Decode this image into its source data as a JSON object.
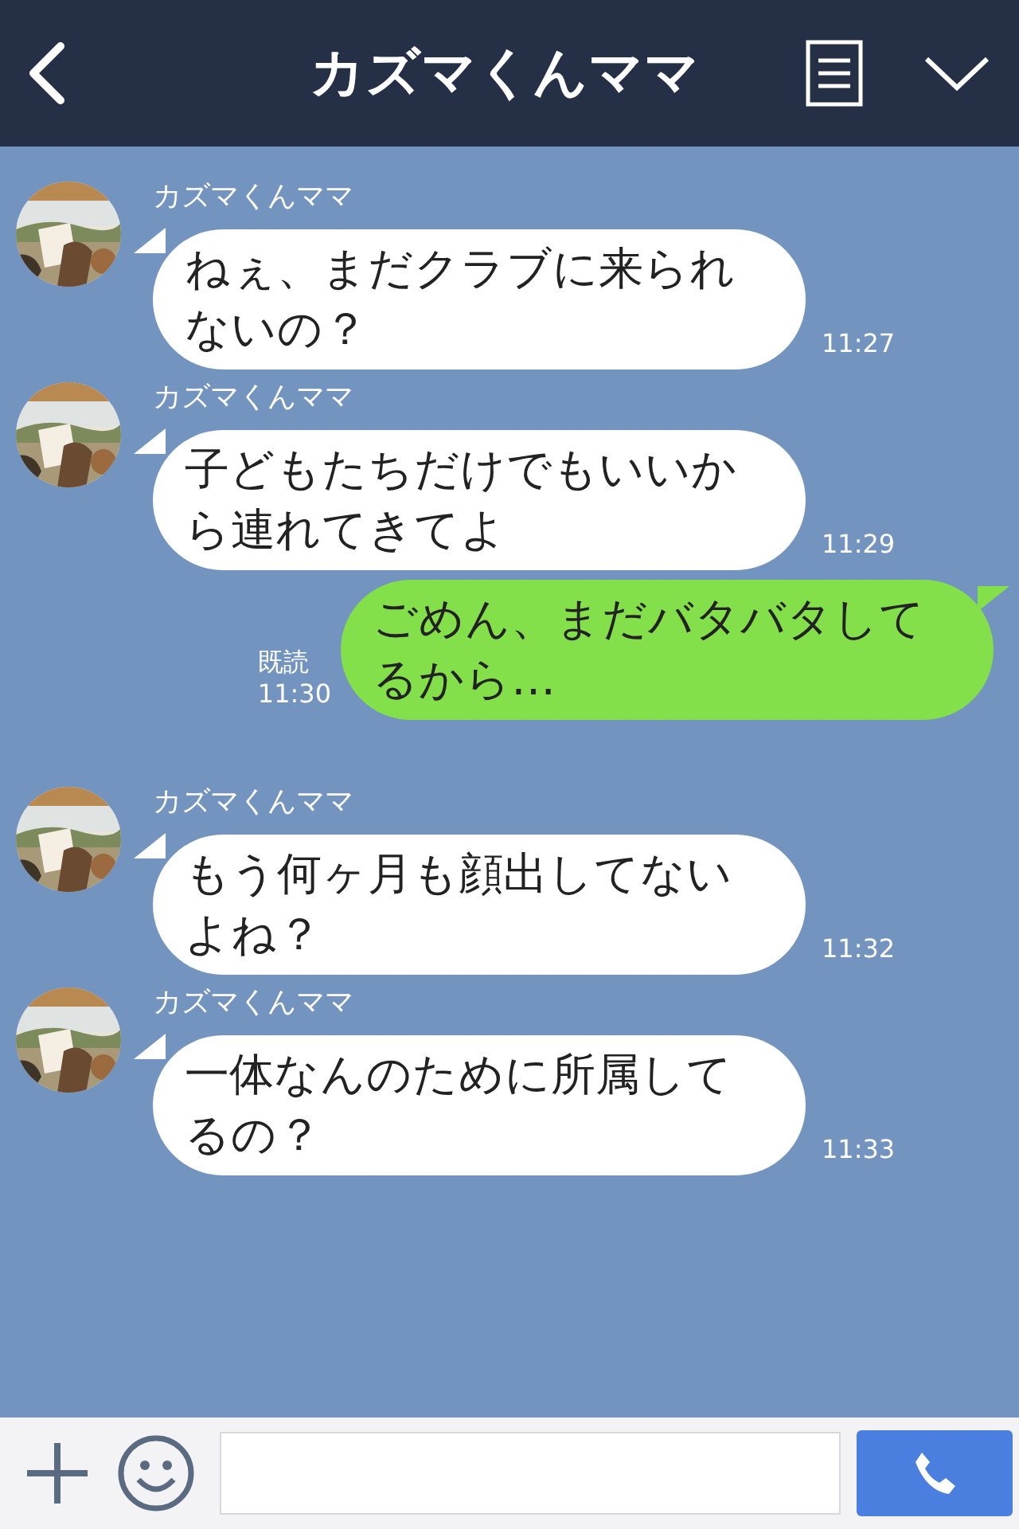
{
  "header": {
    "title": "カズマくんママ"
  },
  "messages": [
    {
      "kind": "received",
      "sender": "カズマくんママ",
      "text": "ねぇ、まだクラブに来られないの？",
      "time": "11:27"
    },
    {
      "kind": "received",
      "sender": "カズマくんママ",
      "text": "子どもたちだけでもいいから連れてきてよ",
      "time": "11:29"
    },
    {
      "kind": "sent",
      "text": "ごめん、まだバタバタしてるから…",
      "read": "既読",
      "time": "11:30"
    },
    {
      "kind": "received",
      "sender": "カズマくんママ",
      "text": "もう何ヶ月も顔出してないよね？",
      "time": "11:32"
    },
    {
      "kind": "received",
      "sender": "カズマくんママ",
      "text": "一体なんのために所属してるの？",
      "time": "11:33"
    }
  ]
}
